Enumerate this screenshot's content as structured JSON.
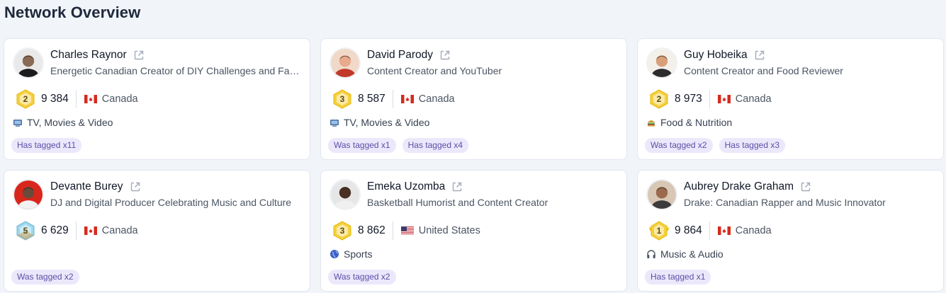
{
  "title": "Network Overview",
  "colors": {
    "accent": "#5b4fa6",
    "tag_bg": "#ece8fb",
    "gold": "#f4d03f"
  },
  "cards": [
    {
      "name": "Charles Raynor",
      "desc": "Energetic Canadian Creator of DIY Challenges and Family Content",
      "rank": "2",
      "rank_icon": "gold-hexagon-badge",
      "score": "9 384",
      "country": "Canada",
      "flag": "canada-flag",
      "category": "TV, Movies & Video",
      "category_icon": "tv-icon",
      "tags": [
        "Has tagged x11"
      ]
    },
    {
      "name": "David Parody",
      "desc": "Content Creator and YouTuber",
      "rank": "3",
      "rank_icon": "gold-hexagon-badge",
      "score": "8 587",
      "country": "Canada",
      "flag": "canada-flag",
      "category": "TV, Movies & Video",
      "category_icon": "tv-icon",
      "tags": [
        "Was tagged x1",
        "Has tagged x4"
      ]
    },
    {
      "name": "Guy Hobeika",
      "desc": "Content Creator and Food Reviewer",
      "rank": "2",
      "rank_icon": "gold-hexagon-badge",
      "score": "8 973",
      "country": "Canada",
      "flag": "canada-flag",
      "category": "Food & Nutrition",
      "category_icon": "burger-icon",
      "tags": [
        "Was tagged x2",
        "Has tagged x3"
      ]
    },
    {
      "name": "Devante Burey",
      "desc": "DJ and Digital Producer Celebrating Music and Culture",
      "rank": "5",
      "rank_icon": "diamond-hexagon-badge",
      "score": "6 629",
      "country": "Canada",
      "flag": "canada-flag",
      "category": "",
      "category_icon": "",
      "tags": [
        "Was tagged x2"
      ]
    },
    {
      "name": "Emeka Uzomba",
      "desc": "Basketball Humorist and Content Creator",
      "rank": "3",
      "rank_icon": "gold-hexagon-badge",
      "score": "8 862",
      "country": "United States",
      "flag": "us-flag",
      "category": "Sports",
      "category_icon": "globe-icon",
      "tags": [
        "Was tagged x2"
      ]
    },
    {
      "name": "Aubrey Drake Graham",
      "desc": "Drake: Canadian Rapper and Music Innovator",
      "rank": "1",
      "rank_icon": "winged-gold-badge",
      "score": "9 864",
      "country": "Canada",
      "flag": "canada-flag",
      "category": "Music & Audio",
      "category_icon": "headphones-icon",
      "tags": [
        "Has tagged x1"
      ]
    }
  ]
}
